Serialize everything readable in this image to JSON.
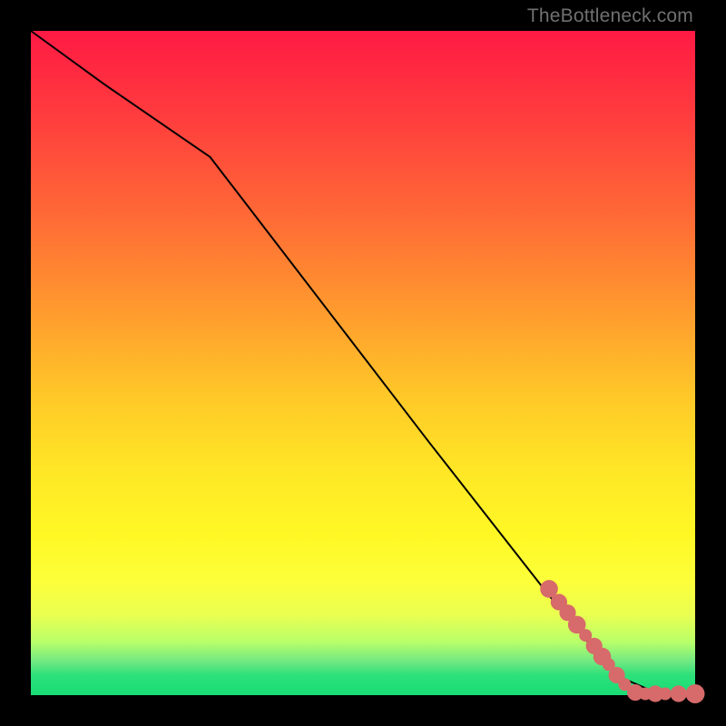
{
  "watermark": "TheBottleneck.com",
  "chart_data": {
    "type": "line",
    "title": "",
    "xlabel": "",
    "ylabel": "",
    "xlim": [
      0,
      100
    ],
    "ylim": [
      0,
      100
    ],
    "line": {
      "x": [
        0,
        11,
        27,
        60,
        78,
        88,
        95,
        100
      ],
      "y": [
        100,
        92,
        81,
        38,
        15,
        3,
        0,
        0
      ]
    },
    "markers": {
      "color": "#d76a6a",
      "points": [
        {
          "x": 78,
          "y": 16,
          "r": 1.4
        },
        {
          "x": 79.5,
          "y": 14,
          "r": 1.3
        },
        {
          "x": 80.8,
          "y": 12.4,
          "r": 1.3
        },
        {
          "x": 82.2,
          "y": 10.6,
          "r": 1.4
        },
        {
          "x": 83.5,
          "y": 9.0,
          "r": 1.0
        },
        {
          "x": 84.8,
          "y": 7.4,
          "r": 1.3
        },
        {
          "x": 86.0,
          "y": 5.8,
          "r": 1.4
        },
        {
          "x": 87.0,
          "y": 4.6,
          "r": 1.0
        },
        {
          "x": 88.2,
          "y": 3.0,
          "r": 1.3
        },
        {
          "x": 89.4,
          "y": 1.6,
          "r": 1.0
        },
        {
          "x": 91.0,
          "y": 0.4,
          "r": 1.3
        },
        {
          "x": 92.5,
          "y": 0.2,
          "r": 1.0
        },
        {
          "x": 94.0,
          "y": 0.2,
          "r": 1.3
        },
        {
          "x": 95.5,
          "y": 0.2,
          "r": 1.0
        },
        {
          "x": 97.5,
          "y": 0.2,
          "r": 1.3
        },
        {
          "x": 100.0,
          "y": 0.2,
          "r": 1.5
        }
      ]
    }
  }
}
